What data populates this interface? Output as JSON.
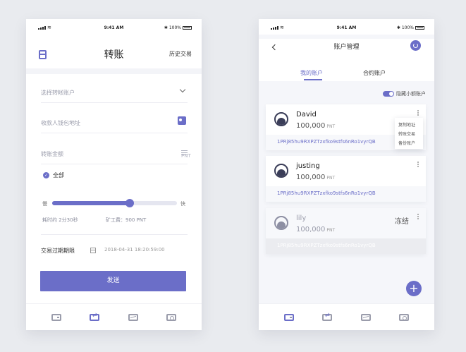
{
  "left": {
    "status": {
      "time": "9:41 AM",
      "battery": "100%"
    },
    "title": "转账",
    "history_label": "历史交易",
    "select_account_placeholder": "选择转帐账户",
    "receiver_placeholder": "收款人钱包地址",
    "amount_placeholder": "转账金额",
    "amount_unit": "PNT",
    "all_label": "全部",
    "speed": {
      "slow": "慢",
      "fast": "快",
      "level": 0.62
    },
    "eta": "耗时约 2分30秒",
    "fee": "矿工费：900 PNT",
    "expiry_label": "交易过期期限",
    "expiry_value": "2018-04-31  18:20:59:00",
    "send_label": "发送"
  },
  "right": {
    "status": {
      "time": "9:41 AM",
      "battery": "100%"
    },
    "title": "账户管理",
    "tabs": [
      "我的账户",
      "合约账户"
    ],
    "hide_small_label": "隐藏小额账户",
    "accounts": [
      {
        "name": "David",
        "balance": "100,000",
        "unit": "PNT",
        "address": "1PRj85hu9RXPZTzxfko9stfs6nRo1vyrQB"
      },
      {
        "name": "justing",
        "balance": "100,000",
        "unit": "PNT",
        "address": "1PRj85hu9RXPZTzxfko9stfs6nRo1vyrQB"
      },
      {
        "name": "lily",
        "balance": "100,000",
        "unit": "PNT",
        "address": "1PRj85hu9RXPZTzxfko9stfs6nRo1vyrQB",
        "status": "冻结"
      }
    ],
    "popup": [
      "复制地址",
      "转账交易",
      "备份账户"
    ],
    "fab": "+"
  },
  "tabbar": {
    "icons": [
      "wallet-icon",
      "swap-icon",
      "chart-icon",
      "user-icon"
    ]
  },
  "colors": {
    "accent": "#6b6ec8"
  }
}
